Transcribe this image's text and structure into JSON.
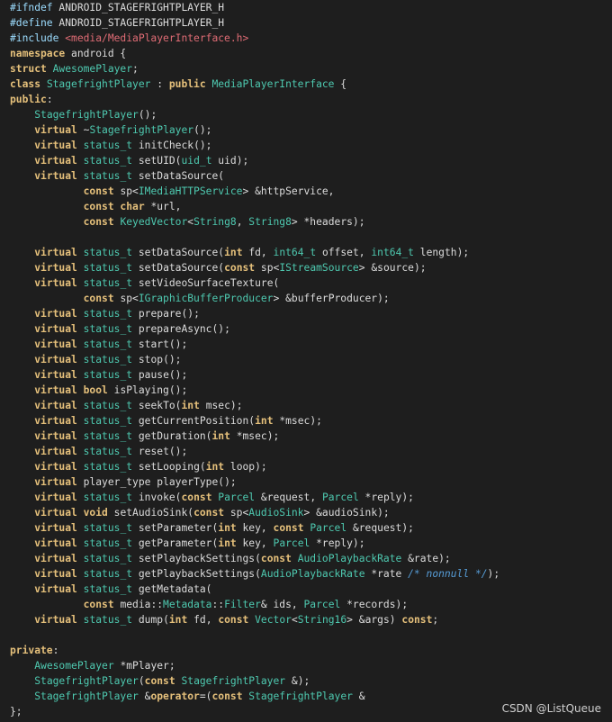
{
  "code": {
    "lines": [
      [
        [
          "pp",
          "#ifndef "
        ],
        [
          "fn",
          "ANDROID_STAGEFRIGHTPLAYER_H"
        ]
      ],
      [
        [
          "pp",
          "#define "
        ],
        [
          "fn",
          "ANDROID_STAGEFRIGHTPLAYER_H"
        ]
      ],
      [
        [
          "pp",
          "#include "
        ],
        [
          "st",
          "<media/MediaPlayerInterface.h>"
        ]
      ],
      [
        [
          "kw",
          "namespace "
        ],
        [
          "fn",
          "android {"
        ]
      ],
      [
        [
          "kw",
          "struct "
        ],
        [
          "ty",
          "AwesomePlayer"
        ],
        [
          "fn",
          ";"
        ]
      ],
      [
        [
          "kw",
          "class "
        ],
        [
          "ty",
          "StagefrightPlayer"
        ],
        [
          "fn",
          " : "
        ],
        [
          "kw",
          "public "
        ],
        [
          "ty",
          "MediaPlayerInterface"
        ],
        [
          "fn",
          " {"
        ]
      ],
      [
        [
          "kw",
          "public"
        ],
        [
          "fn",
          ":"
        ]
      ],
      [
        [
          "fn",
          "    "
        ],
        [
          "ty",
          "StagefrightPlayer"
        ],
        [
          "fn",
          "();"
        ]
      ],
      [
        [
          "fn",
          "    "
        ],
        [
          "kw",
          "virtual "
        ],
        [
          "fn",
          "~"
        ],
        [
          "ty",
          "StagefrightPlayer"
        ],
        [
          "fn",
          "();"
        ]
      ],
      [
        [
          "fn",
          "    "
        ],
        [
          "kw",
          "virtual "
        ],
        [
          "ty",
          "status_t"
        ],
        [
          "fn",
          " initCheck();"
        ]
      ],
      [
        [
          "fn",
          "    "
        ],
        [
          "kw",
          "virtual "
        ],
        [
          "ty",
          "status_t"
        ],
        [
          "fn",
          " setUID("
        ],
        [
          "ty",
          "uid_t"
        ],
        [
          "fn",
          " uid);"
        ]
      ],
      [
        [
          "fn",
          "    "
        ],
        [
          "kw",
          "virtual "
        ],
        [
          "ty",
          "status_t"
        ],
        [
          "fn",
          " setDataSource("
        ]
      ],
      [
        [
          "fn",
          "            "
        ],
        [
          "kw",
          "const "
        ],
        [
          "fn",
          "sp<"
        ],
        [
          "ty",
          "IMediaHTTPService"
        ],
        [
          "fn",
          "> &httpService,"
        ]
      ],
      [
        [
          "fn",
          "            "
        ],
        [
          "kw",
          "const char "
        ],
        [
          "fn",
          "*url,"
        ]
      ],
      [
        [
          "fn",
          "            "
        ],
        [
          "kw",
          "const "
        ],
        [
          "ty",
          "KeyedVector"
        ],
        [
          "fn",
          "<"
        ],
        [
          "ty",
          "String8"
        ],
        [
          "fn",
          ", "
        ],
        [
          "ty",
          "String8"
        ],
        [
          "fn",
          "> *headers);"
        ]
      ],
      [
        [
          "fn",
          ""
        ]
      ],
      [
        [
          "fn",
          "    "
        ],
        [
          "kw",
          "virtual "
        ],
        [
          "ty",
          "status_t"
        ],
        [
          "fn",
          " setDataSource("
        ],
        [
          "kw",
          "int "
        ],
        [
          "fn",
          "fd, "
        ],
        [
          "ty",
          "int64_t"
        ],
        [
          "fn",
          " offset, "
        ],
        [
          "ty",
          "int64_t"
        ],
        [
          "fn",
          " length);"
        ]
      ],
      [
        [
          "fn",
          "    "
        ],
        [
          "kw",
          "virtual "
        ],
        [
          "ty",
          "status_t"
        ],
        [
          "fn",
          " setDataSource("
        ],
        [
          "kw",
          "const "
        ],
        [
          "fn",
          "sp<"
        ],
        [
          "ty",
          "IStreamSource"
        ],
        [
          "fn",
          "> &source);"
        ]
      ],
      [
        [
          "fn",
          "    "
        ],
        [
          "kw",
          "virtual "
        ],
        [
          "ty",
          "status_t"
        ],
        [
          "fn",
          " setVideoSurfaceTexture("
        ]
      ],
      [
        [
          "fn",
          "            "
        ],
        [
          "kw",
          "const "
        ],
        [
          "fn",
          "sp<"
        ],
        [
          "ty",
          "IGraphicBufferProducer"
        ],
        [
          "fn",
          "> &bufferProducer);"
        ]
      ],
      [
        [
          "fn",
          "    "
        ],
        [
          "kw",
          "virtual "
        ],
        [
          "ty",
          "status_t"
        ],
        [
          "fn",
          " prepare();"
        ]
      ],
      [
        [
          "fn",
          "    "
        ],
        [
          "kw",
          "virtual "
        ],
        [
          "ty",
          "status_t"
        ],
        [
          "fn",
          " prepareAsync();"
        ]
      ],
      [
        [
          "fn",
          "    "
        ],
        [
          "kw",
          "virtual "
        ],
        [
          "ty",
          "status_t"
        ],
        [
          "fn",
          " start();"
        ]
      ],
      [
        [
          "fn",
          "    "
        ],
        [
          "kw",
          "virtual "
        ],
        [
          "ty",
          "status_t"
        ],
        [
          "fn",
          " stop();"
        ]
      ],
      [
        [
          "fn",
          "    "
        ],
        [
          "kw",
          "virtual "
        ],
        [
          "ty",
          "status_t"
        ],
        [
          "fn",
          " pause();"
        ]
      ],
      [
        [
          "fn",
          "    "
        ],
        [
          "kw",
          "virtual bool "
        ],
        [
          "fn",
          "isPlaying();"
        ]
      ],
      [
        [
          "fn",
          "    "
        ],
        [
          "kw",
          "virtual "
        ],
        [
          "ty",
          "status_t"
        ],
        [
          "fn",
          " seekTo("
        ],
        [
          "kw",
          "int "
        ],
        [
          "fn",
          "msec);"
        ]
      ],
      [
        [
          "fn",
          "    "
        ],
        [
          "kw",
          "virtual "
        ],
        [
          "ty",
          "status_t"
        ],
        [
          "fn",
          " getCurrentPosition("
        ],
        [
          "kw",
          "int "
        ],
        [
          "fn",
          "*msec);"
        ]
      ],
      [
        [
          "fn",
          "    "
        ],
        [
          "kw",
          "virtual "
        ],
        [
          "ty",
          "status_t"
        ],
        [
          "fn",
          " getDuration("
        ],
        [
          "kw",
          "int "
        ],
        [
          "fn",
          "*msec);"
        ]
      ],
      [
        [
          "fn",
          "    "
        ],
        [
          "kw",
          "virtual "
        ],
        [
          "ty",
          "status_t"
        ],
        [
          "fn",
          " reset();"
        ]
      ],
      [
        [
          "fn",
          "    "
        ],
        [
          "kw",
          "virtual "
        ],
        [
          "ty",
          "status_t"
        ],
        [
          "fn",
          " setLooping("
        ],
        [
          "kw",
          "int "
        ],
        [
          "fn",
          "loop);"
        ]
      ],
      [
        [
          "fn",
          "    "
        ],
        [
          "kw",
          "virtual "
        ],
        [
          "fn",
          "player_type playerType();"
        ]
      ],
      [
        [
          "fn",
          "    "
        ],
        [
          "kw",
          "virtual "
        ],
        [
          "ty",
          "status_t"
        ],
        [
          "fn",
          " invoke("
        ],
        [
          "kw",
          "const "
        ],
        [
          "ty",
          "Parcel"
        ],
        [
          "fn",
          " &request, "
        ],
        [
          "ty",
          "Parcel"
        ],
        [
          "fn",
          " *reply);"
        ]
      ],
      [
        [
          "fn",
          "    "
        ],
        [
          "kw",
          "virtual void "
        ],
        [
          "fn",
          "setAudioSink("
        ],
        [
          "kw",
          "const "
        ],
        [
          "fn",
          "sp<"
        ],
        [
          "ty",
          "AudioSink"
        ],
        [
          "fn",
          "> &audioSink);"
        ]
      ],
      [
        [
          "fn",
          "    "
        ],
        [
          "kw",
          "virtual "
        ],
        [
          "ty",
          "status_t"
        ],
        [
          "fn",
          " setParameter("
        ],
        [
          "kw",
          "int "
        ],
        [
          "fn",
          "key, "
        ],
        [
          "kw",
          "const "
        ],
        [
          "ty",
          "Parcel"
        ],
        [
          "fn",
          " &request);"
        ]
      ],
      [
        [
          "fn",
          "    "
        ],
        [
          "kw",
          "virtual "
        ],
        [
          "ty",
          "status_t"
        ],
        [
          "fn",
          " getParameter("
        ],
        [
          "kw",
          "int "
        ],
        [
          "fn",
          "key, "
        ],
        [
          "ty",
          "Parcel"
        ],
        [
          "fn",
          " *reply);"
        ]
      ],
      [
        [
          "fn",
          "    "
        ],
        [
          "kw",
          "virtual "
        ],
        [
          "ty",
          "status_t"
        ],
        [
          "fn",
          " setPlaybackSettings("
        ],
        [
          "kw",
          "const "
        ],
        [
          "ty",
          "AudioPlaybackRate"
        ],
        [
          "fn",
          " &rate);"
        ]
      ],
      [
        [
          "fn",
          "    "
        ],
        [
          "kw",
          "virtual "
        ],
        [
          "ty",
          "status_t"
        ],
        [
          "fn",
          " getPlaybackSettings("
        ],
        [
          "ty",
          "AudioPlaybackRate"
        ],
        [
          "fn",
          " *rate "
        ],
        [
          "cm",
          "/* nonnull */"
        ],
        [
          "fn",
          ");"
        ]
      ],
      [
        [
          "fn",
          "    "
        ],
        [
          "kw",
          "virtual "
        ],
        [
          "ty",
          "status_t"
        ],
        [
          "fn",
          " getMetadata("
        ]
      ],
      [
        [
          "fn",
          "            "
        ],
        [
          "kw",
          "const "
        ],
        [
          "fn",
          "media::"
        ],
        [
          "ty",
          "Metadata"
        ],
        [
          "fn",
          "::"
        ],
        [
          "ty",
          "Filter"
        ],
        [
          "fn",
          "& ids, "
        ],
        [
          "ty",
          "Parcel"
        ],
        [
          "fn",
          " *records);"
        ]
      ],
      [
        [
          "fn",
          "    "
        ],
        [
          "kw",
          "virtual "
        ],
        [
          "ty",
          "status_t"
        ],
        [
          "fn",
          " dump("
        ],
        [
          "kw",
          "int "
        ],
        [
          "fn",
          "fd, "
        ],
        [
          "kw",
          "const "
        ],
        [
          "ty",
          "Vector"
        ],
        [
          "fn",
          "<"
        ],
        [
          "ty",
          "String16"
        ],
        [
          "fn",
          "> &args) "
        ],
        [
          "kw",
          "const"
        ],
        [
          "fn",
          ";"
        ]
      ],
      [
        [
          "fn",
          ""
        ]
      ],
      [
        [
          "kw",
          "private"
        ],
        [
          "fn",
          ":"
        ]
      ],
      [
        [
          "fn",
          "    "
        ],
        [
          "ty",
          "AwesomePlayer"
        ],
        [
          "fn",
          " *mPlayer;"
        ]
      ],
      [
        [
          "fn",
          "    "
        ],
        [
          "ty",
          "StagefrightPlayer"
        ],
        [
          "fn",
          "("
        ],
        [
          "kw",
          "const "
        ],
        [
          "ty",
          "StagefrightPlayer"
        ],
        [
          "fn",
          " &);"
        ]
      ],
      [
        [
          "fn",
          "    "
        ],
        [
          "ty",
          "StagefrightPlayer"
        ],
        [
          "fn",
          " &"
        ],
        [
          "kw",
          "operator"
        ],
        [
          "fn",
          "=("
        ],
        [
          "kw",
          "const "
        ],
        [
          "ty",
          "StagefrightPlayer"
        ],
        [
          "fn",
          " &"
        ]
      ],
      [
        [
          "fn",
          "};"
        ]
      ]
    ]
  },
  "watermark": "CSDN @ListQueue"
}
